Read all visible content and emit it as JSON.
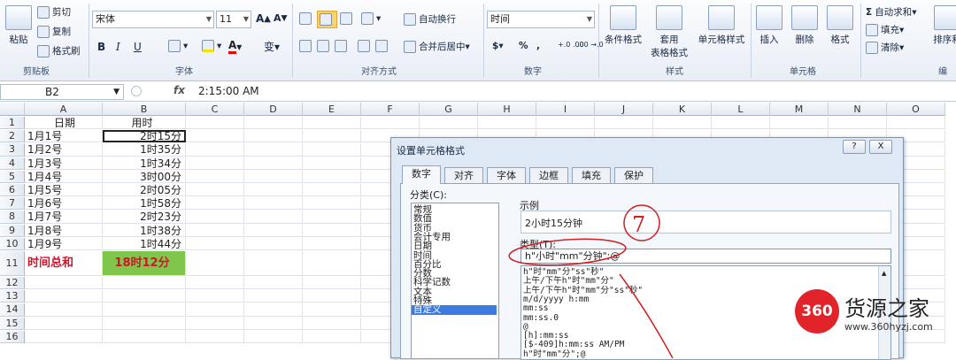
{
  "ribbon": {
    "clipboard": {
      "paste": "粘贴",
      "cut": "剪切",
      "copy": "复制",
      "format_painter": "格式刷",
      "label": "剪贴板"
    },
    "font": {
      "name": "宋体",
      "size": "11",
      "bold": "B",
      "italic": "I",
      "underline": "U",
      "phonetic": "变",
      "label": "字体"
    },
    "alignment": {
      "wrap": "自动换行",
      "merge": "合并后居中",
      "label": "对齐方式"
    },
    "number": {
      "format": "时间",
      "currency": "$",
      "percent": "%",
      "comma": ",",
      "dec_inc": "+.0 .00",
      "dec_dec": ".00 →.0",
      "label": "数字"
    },
    "styles": {
      "conditional": "条件格式",
      "table": "套用",
      "table2": "表格格式",
      "cell_styles": "单元格样式",
      "label": "样式"
    },
    "cells": {
      "insert": "插入",
      "delete": "删除",
      "format": "格式",
      "label": "单元格"
    },
    "editing": {
      "autosum": "自动求和",
      "fill": "填充",
      "clear": "清除",
      "sort": "排序和",
      "label": "编"
    }
  },
  "formula_bar": {
    "name_box": "B2",
    "fx": "fx",
    "value": "2:15:00 AM"
  },
  "columns": [
    "A",
    "B",
    "C",
    "D",
    "E",
    "F",
    "G",
    "H",
    "I",
    "J",
    "K",
    "L",
    "M",
    "N",
    "O"
  ],
  "rows": [
    {
      "n": "1",
      "a": "日期",
      "b": "用时"
    },
    {
      "n": "2",
      "a": "1月1号",
      "b": "2时15分"
    },
    {
      "n": "3",
      "a": "1月2号",
      "b": "1时35分"
    },
    {
      "n": "4",
      "a": "1月3号",
      "b": "1时34分"
    },
    {
      "n": "5",
      "a": "1月4号",
      "b": "3时00分"
    },
    {
      "n": "6",
      "a": "1月5号",
      "b": "2时05分"
    },
    {
      "n": "7",
      "a": "1月6号",
      "b": "1时58分"
    },
    {
      "n": "8",
      "a": "1月7号",
      "b": "2时23分"
    },
    {
      "n": "9",
      "a": "1月8号",
      "b": "1时38分"
    },
    {
      "n": "10",
      "a": "1月9号",
      "b": "1时44分"
    },
    {
      "n": "11",
      "a": "时间总和",
      "b": "18时12分"
    },
    {
      "n": "12",
      "a": "",
      "b": ""
    },
    {
      "n": "13",
      "a": "",
      "b": ""
    },
    {
      "n": "14",
      "a": "",
      "b": ""
    },
    {
      "n": "15",
      "a": "",
      "b": ""
    },
    {
      "n": "16",
      "a": "",
      "b": ""
    }
  ],
  "dialog": {
    "title": "设置单元格格式",
    "help": "?",
    "close": "X",
    "tabs": [
      "数字",
      "对齐",
      "字体",
      "边框",
      "填充",
      "保护"
    ],
    "category_label": "分类(C):",
    "categories": [
      "常规",
      "数值",
      "货币",
      "会计专用",
      "日期",
      "时间",
      "百分比",
      "分数",
      "科学记数",
      "文本",
      "特殊",
      "自定义"
    ],
    "sample_label": "示例",
    "sample_value": "2小时15分钟",
    "type_label": "类型(T):",
    "type_value": "h\"小时\"mm\"分钟\";@",
    "formats": [
      "h\"时\"mm\"分\"ss\"秒\"",
      "上午/下午h\"时\"mm\"分\"",
      "上午/下午h\"时\"mm\"分\"ss\"秒\"",
      "m/d/yyyy h:mm",
      "mm:ss",
      "mm:ss.0",
      "@",
      "[h]:mm:ss",
      "[$-409]h:mm:ss AM/PM",
      "h\"时\"mm\"分\";@"
    ]
  },
  "annotation": {
    "number": "7"
  },
  "watermark": {
    "brand": "360",
    "name": "货源之家",
    "url": "www.360hyzj.com"
  },
  "colors": {
    "total_text": "#d0142b",
    "total_fill": "#7fc64a",
    "annotation_red": "#d02020"
  }
}
